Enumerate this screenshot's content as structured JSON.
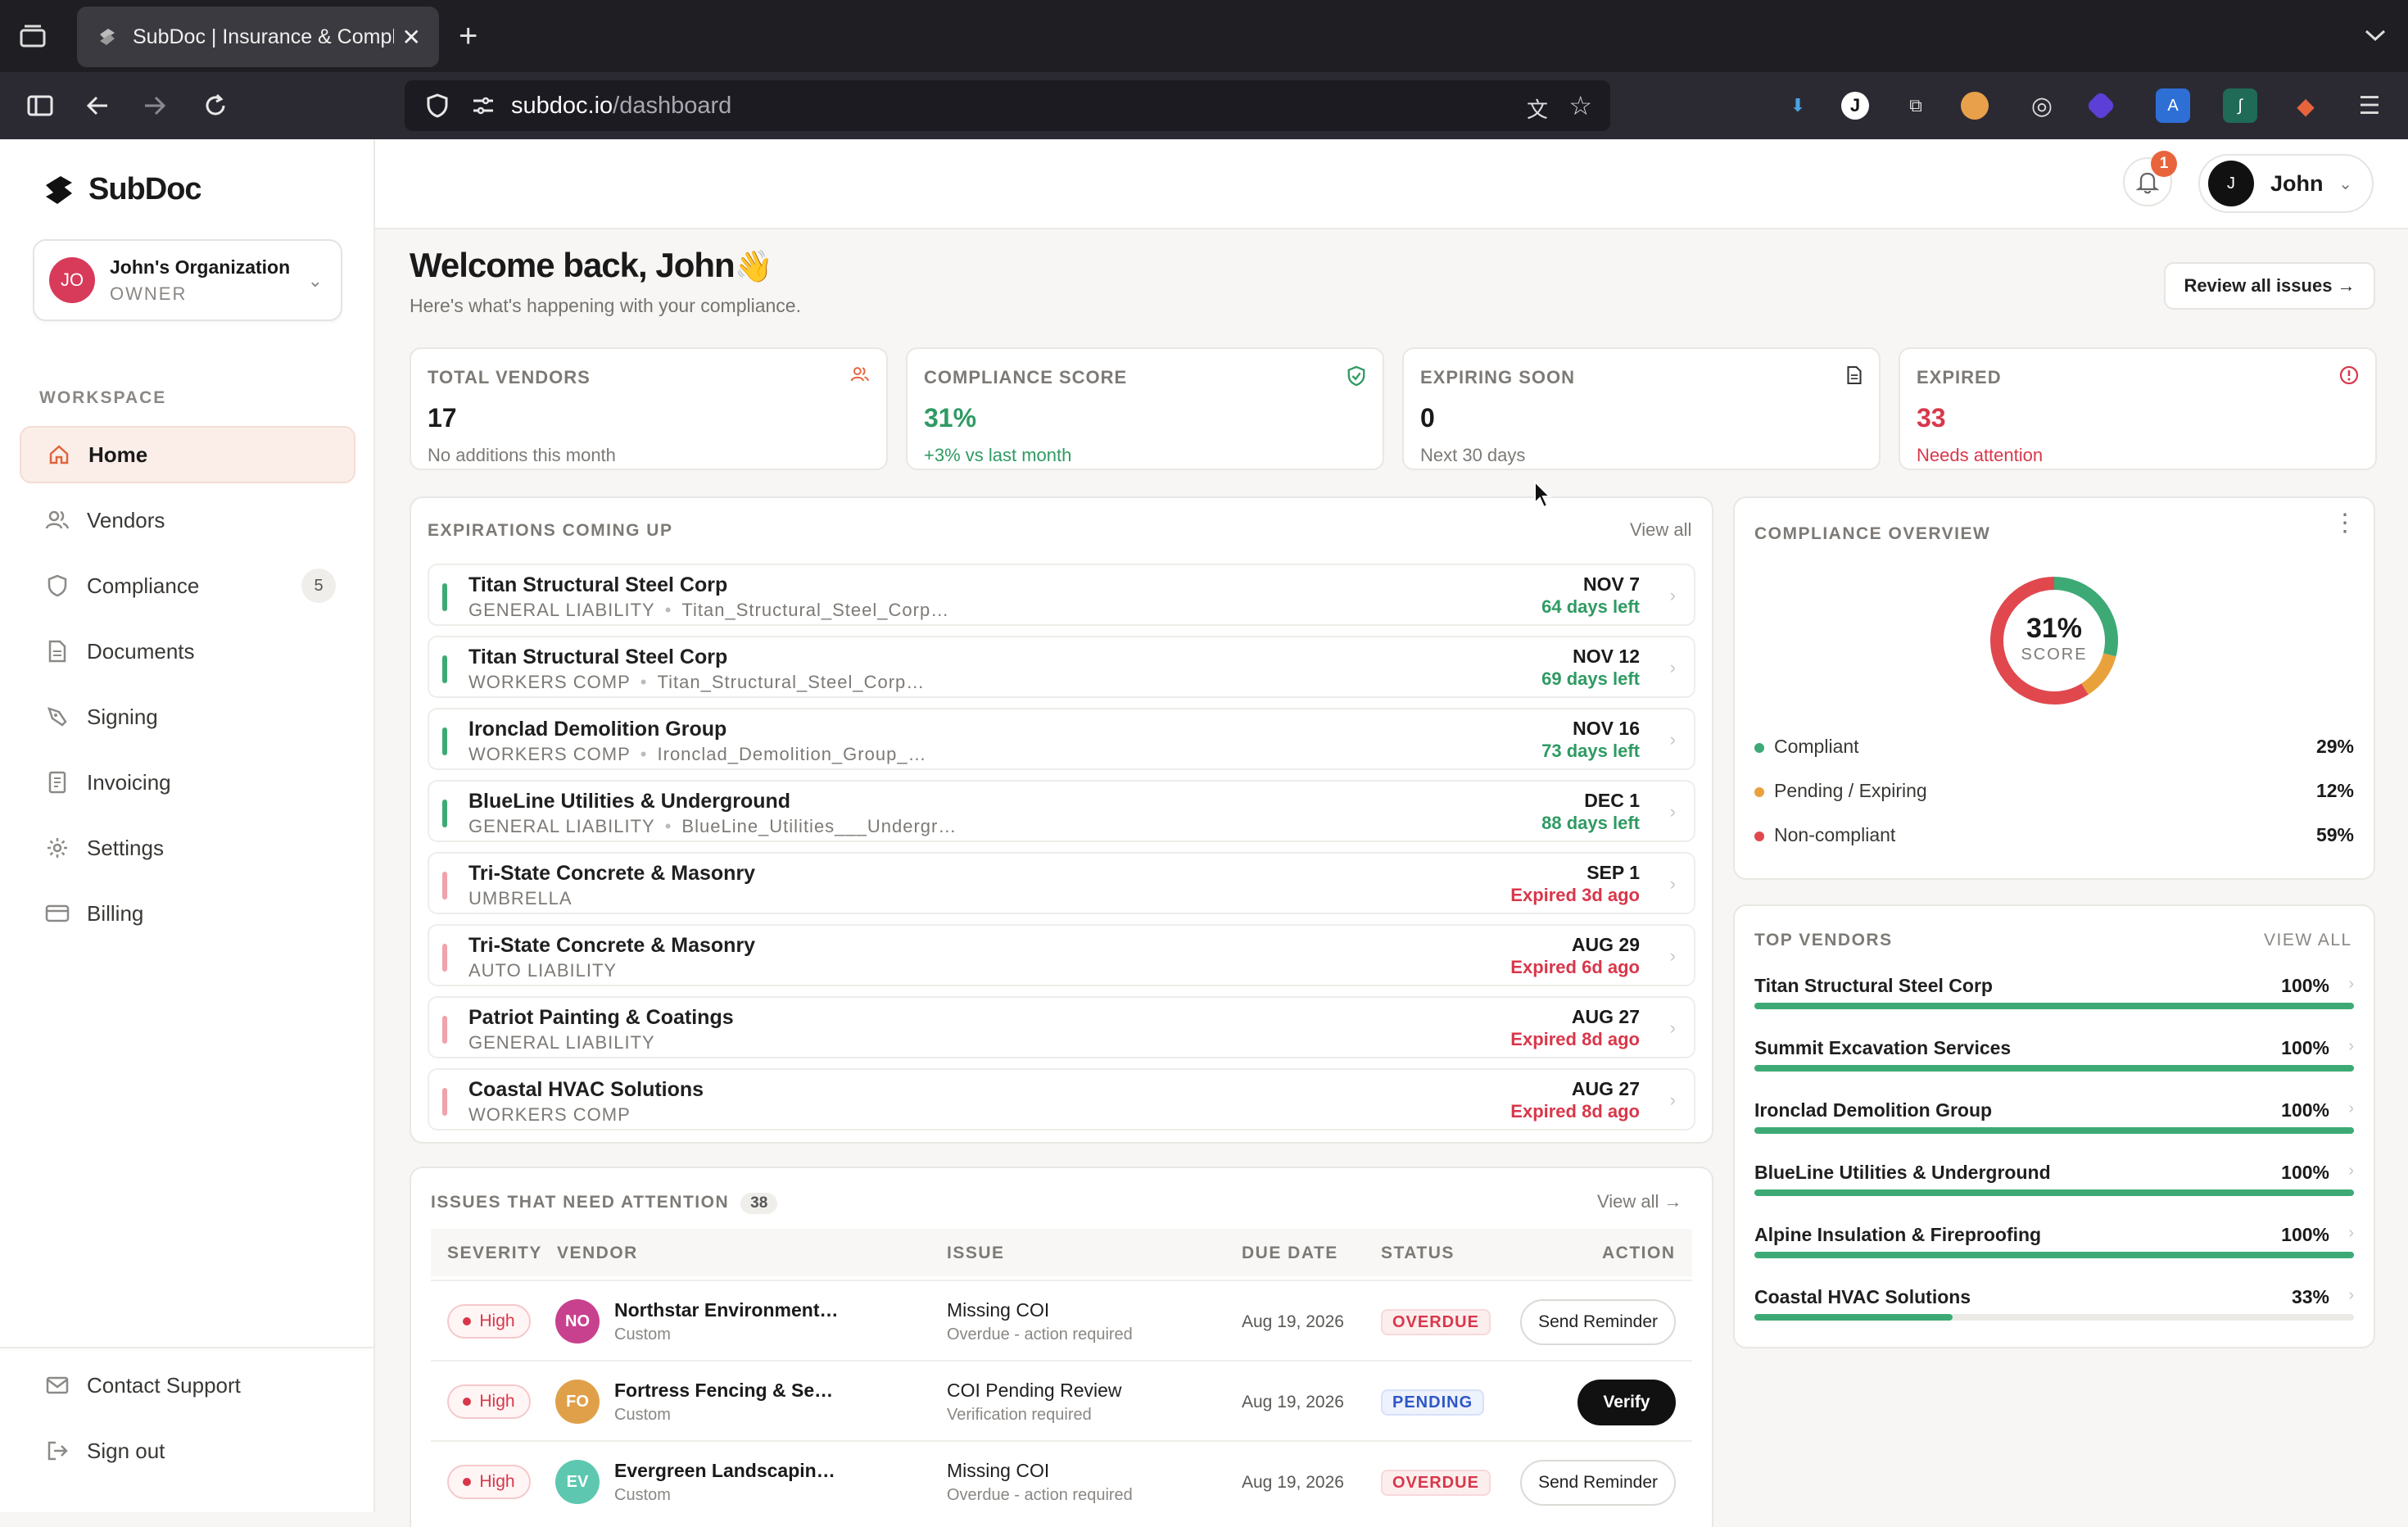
{
  "browser": {
    "tab_title": "SubDoc | Insurance & Complian",
    "url_host": "subdoc.io",
    "url_path": "/dashboard"
  },
  "app": {
    "brand": "SubDoc",
    "org": {
      "initials": "JO",
      "name": "John's Organization",
      "role": "OWNER"
    },
    "workspace_label": "WORKSPACE",
    "menu": [
      {
        "label": "Home",
        "icon": "home-icon"
      },
      {
        "label": "Vendors",
        "icon": "users-icon"
      },
      {
        "label": "Compliance",
        "icon": "shield-icon",
        "count": "5"
      },
      {
        "label": "Documents",
        "icon": "document-icon"
      },
      {
        "label": "Signing",
        "icon": "pen-icon"
      },
      {
        "label": "Invoicing",
        "icon": "invoice-icon"
      },
      {
        "label": "Settings",
        "icon": "gear-icon"
      },
      {
        "label": "Billing",
        "icon": "card-icon"
      }
    ],
    "bottom_menu": [
      {
        "label": "Contact Support",
        "icon": "mail-icon"
      },
      {
        "label": "Sign out",
        "icon": "signout-icon"
      }
    ]
  },
  "header": {
    "notif_count": "1",
    "user_initial": "J",
    "user_name": "John"
  },
  "welcome": {
    "title": "Welcome back, John",
    "emoji": "👋",
    "subtitle": "Here's what's happening with your compliance.",
    "review_button": "Review all issues →"
  },
  "stats": [
    {
      "label": "TOTAL VENDORS",
      "value": "17",
      "sub": "No additions this month",
      "value_color": "#1a1a1a",
      "sub_color": "#7d7a76"
    },
    {
      "label": "COMPLIANCE SCORE",
      "value": "31%",
      "sub": "+3% vs last month",
      "value_color": "#2f9a63",
      "sub_color": "#2f9a63"
    },
    {
      "label": "EXPIRING SOON",
      "value": "0",
      "sub": "Next 30 days",
      "value_color": "#1a1a1a",
      "sub_color": "#7d7a76"
    },
    {
      "label": "EXPIRED",
      "value": "33",
      "sub": "Needs attention",
      "value_color": "#d8374a",
      "sub_color": "#d8374a"
    }
  ],
  "expirations": {
    "title": "EXPIRATIONS COMING UP",
    "view_all": "View all",
    "rows": [
      {
        "vendor": "Titan Structural Steel Corp",
        "type": "GENERAL LIABILITY",
        "file": "Titan_Structural_Steel_Corp…",
        "date": "NOV 7",
        "rel": "64 days left",
        "status": "ok"
      },
      {
        "vendor": "Titan Structural Steel Corp",
        "type": "WORKERS COMP",
        "file": "Titan_Structural_Steel_Corp…",
        "date": "NOV 12",
        "rel": "69 days left",
        "status": "ok"
      },
      {
        "vendor": "Ironclad Demolition Group",
        "type": "WORKERS COMP",
        "file": "Ironclad_Demolition_Group_…",
        "date": "NOV 16",
        "rel": "73 days left",
        "status": "ok"
      },
      {
        "vendor": "BlueLine Utilities & Underground",
        "type": "GENERAL LIABILITY",
        "file": "BlueLine_Utilities___Undergr…",
        "date": "DEC 1",
        "rel": "88 days left",
        "status": "ok"
      },
      {
        "vendor": "Tri-State Concrete & Masonry",
        "type": "UMBRELLA",
        "file": "",
        "date": "SEP 1",
        "rel": "Expired 3d ago",
        "status": "expired"
      },
      {
        "vendor": "Tri-State Concrete & Masonry",
        "type": "AUTO LIABILITY",
        "file": "",
        "date": "AUG 29",
        "rel": "Expired 6d ago",
        "status": "expired"
      },
      {
        "vendor": "Patriot Painting & Coatings",
        "type": "GENERAL LIABILITY",
        "file": "",
        "date": "AUG 27",
        "rel": "Expired 8d ago",
        "status": "expired"
      },
      {
        "vendor": "Coastal HVAC Solutions",
        "type": "WORKERS COMP",
        "file": "",
        "date": "AUG 27",
        "rel": "Expired 8d ago",
        "status": "expired"
      }
    ]
  },
  "overview": {
    "title": "COMPLIANCE OVERVIEW",
    "score": "31%",
    "score_label": "SCORE",
    "legend": [
      {
        "label": "Compliant",
        "pct": "29%",
        "value": 29,
        "color": "#3daa75"
      },
      {
        "label": "Pending / Expiring",
        "pct": "12%",
        "value": 12,
        "color": "#e9a23b"
      },
      {
        "label": "Non-compliant",
        "pct": "59%",
        "value": 59,
        "color": "#e0484e"
      }
    ]
  },
  "top_vendors": {
    "title": "TOP VENDORS",
    "view_all": "VIEW ALL",
    "rows": [
      {
        "name": "Titan Structural Steel Corp",
        "pct": "100%",
        "value": 100
      },
      {
        "name": "Summit Excavation Services",
        "pct": "100%",
        "value": 100
      },
      {
        "name": "Ironclad Demolition Group",
        "pct": "100%",
        "value": 100
      },
      {
        "name": "BlueLine Utilities & Underground",
        "pct": "100%",
        "value": 100
      },
      {
        "name": "Alpine Insulation & Fireproofing",
        "pct": "100%",
        "value": 100
      },
      {
        "name": "Coastal HVAC Solutions",
        "pct": "33%",
        "value": 33
      }
    ]
  },
  "issues": {
    "title": "ISSUES THAT NEED ATTENTION",
    "count": "38",
    "view_all": "View all →",
    "columns": [
      "SEVERITY",
      "VENDOR",
      "ISSUE",
      "DUE DATE",
      "STATUS",
      "ACTION"
    ],
    "rows": [
      {
        "severity": "High",
        "initials": "NO",
        "av_color": "#c8418f",
        "vendor": "Northstar Environment…",
        "vendor_sub": "Custom",
        "issue": "Missing COI",
        "issue_sub": "Overdue - action required",
        "due": "Aug 19, 2026",
        "status": "OVERDUE",
        "action": "Send Reminder"
      },
      {
        "severity": "High",
        "initials": "FO",
        "av_color": "#e0a04a",
        "vendor": "Fortress Fencing & Se…",
        "vendor_sub": "Custom",
        "issue": "COI Pending Review",
        "issue_sub": "Verification required",
        "due": "Aug 19, 2026",
        "status": "PENDING",
        "action": "Verify"
      },
      {
        "severity": "High",
        "initials": "EV",
        "av_color": "#5ec7b0",
        "vendor": "Evergreen Landscapin…",
        "vendor_sub": "Custom",
        "issue": "Missing COI",
        "issue_sub": "Overdue - action required",
        "due": "Aug 19, 2026",
        "status": "OVERDUE",
        "action": "Send Reminder"
      }
    ]
  }
}
